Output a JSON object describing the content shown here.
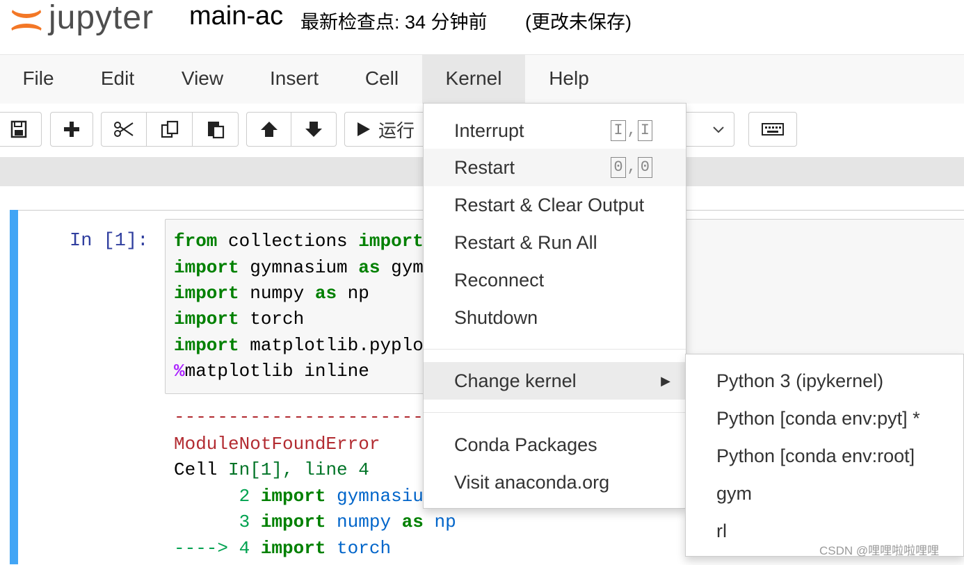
{
  "header": {
    "logo_text": "jupyter",
    "notebook_name": "main-ac",
    "checkpoint": "最新检查点: 34 分钟前",
    "unsaved": "(更改未保存)"
  },
  "menubar": {
    "items": [
      "File",
      "Edit",
      "View",
      "Insert",
      "Cell",
      "Kernel",
      "Help"
    ],
    "active": "Kernel"
  },
  "toolbar": {
    "run_label": "运行",
    "icons": [
      "save-icon",
      "plus-icon",
      "cut-icon",
      "copy-icon",
      "paste-icon",
      "arrow-up-icon",
      "arrow-down-icon",
      "run-icon",
      "chevron-down-icon",
      "keyboard-icon"
    ]
  },
  "cell": {
    "prompt": "In  [1]:",
    "code": [
      {
        "kw": "from",
        "rest": " collections ",
        "kw2": "import"
      },
      {
        "kw": "import",
        "rest": " gymnasium ",
        "kw2": "as",
        "rest2": " gym"
      },
      {
        "kw": "import",
        "rest": " numpy ",
        "kw2": "as",
        "rest2": " np"
      },
      {
        "kw": "import",
        "rest": " torch"
      },
      {
        "kw": "import",
        "rest": " matplotlib.pyplo"
      },
      {
        "magic": "%",
        "rest": "matplotlib inline"
      }
    ],
    "output": {
      "dashes": "-----------------------",
      "error_name": "ModuleNotFoundError",
      "cell_ref_a": "Cell ",
      "cell_ref_b": "In[1], line 4",
      "line2_num": "      2 ",
      "line2_kw": "import",
      "line2_rest": " gymnasiu",
      "line3_num": "      3 ",
      "line3_kw": "import",
      "line3_mod": " numpy ",
      "line3_as": "as",
      "line3_alias": " np",
      "line4_arrow": "----> 4 ",
      "line4_kw": "import",
      "line4_mod": " torch"
    }
  },
  "kernel_menu": {
    "items": [
      {
        "label": "Interrupt",
        "shortcut": [
          "I",
          "I"
        ]
      },
      {
        "label": "Restart",
        "shortcut": [
          "0",
          "0"
        ]
      },
      {
        "label": "Restart & Clear Output"
      },
      {
        "label": "Restart & Run All"
      },
      {
        "label": "Reconnect"
      },
      {
        "label": "Shutdown"
      },
      {
        "label": "Change kernel"
      },
      {
        "label": "Conda Packages"
      },
      {
        "label": "Visit anaconda.org"
      }
    ],
    "shortcut_sep": ","
  },
  "change_kernel_submenu": {
    "items": [
      "Python 3 (ipykernel)",
      "Python [conda env:pyt] *",
      "Python [conda env:root]",
      "gym",
      "rl"
    ]
  },
  "watermark": "CSDN @哩哩啦啦哩哩",
  "colors": {
    "accent_orange": "#f37726",
    "cell_bar": "#42a5f5",
    "prompt": "#303f9f",
    "keyword": "#008000",
    "error": "#b22b31"
  }
}
